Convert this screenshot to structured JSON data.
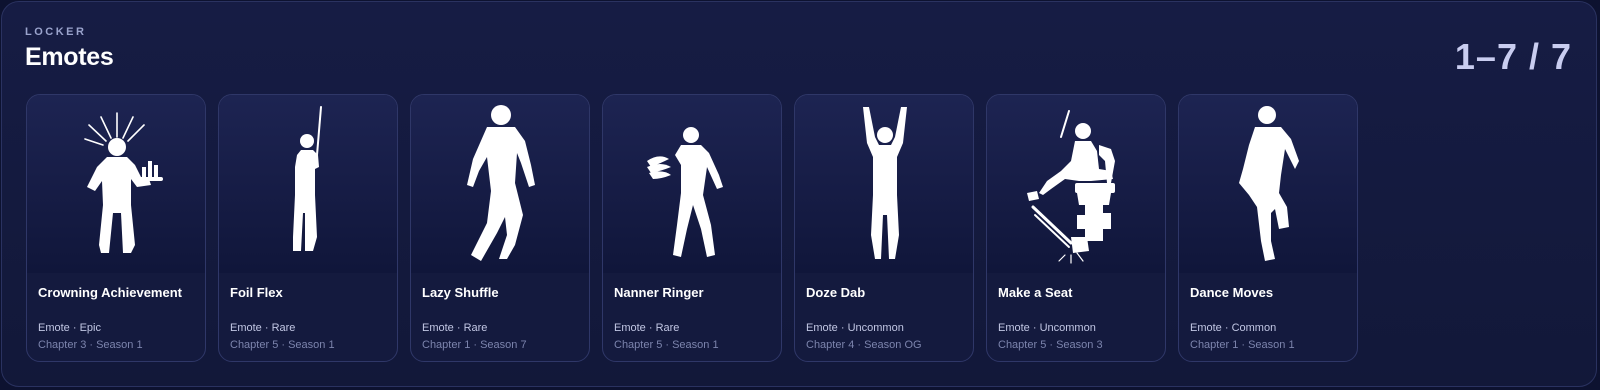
{
  "header": {
    "eyebrow": "LOCKER",
    "title": "Emotes",
    "counter": "1–7 / 7"
  },
  "cards": [
    {
      "name": "Crowning Achievement",
      "meta": "Emote · Epic",
      "season": "Chapter 3 · Season 1",
      "icon": "crowning-achievement-icon"
    },
    {
      "name": "Foil Flex",
      "meta": "Emote · Rare",
      "season": "Chapter 5 · Season 1",
      "icon": "foil-flex-icon"
    },
    {
      "name": "Lazy Shuffle",
      "meta": "Emote · Rare",
      "season": "Chapter 1 · Season 7",
      "icon": "lazy-shuffle-icon"
    },
    {
      "name": "Nanner Ringer",
      "meta": "Emote · Rare",
      "season": "Chapter 5 · Season 1",
      "icon": "nanner-ringer-icon"
    },
    {
      "name": "Doze Dab",
      "meta": "Emote · Uncommon",
      "season": "Chapter 4 · Season OG",
      "icon": "doze-dab-icon"
    },
    {
      "name": "Make a Seat",
      "meta": "Emote · Uncommon",
      "season": "Chapter 5 · Season 3",
      "icon": "make-a-seat-icon"
    },
    {
      "name": "Dance Moves",
      "meta": "Emote · Common",
      "season": "Chapter 1 · Season 1",
      "icon": "dance-moves-icon"
    }
  ],
  "colors": {
    "background": "#0d1230",
    "panel": "#161c44",
    "card": "#141a3e",
    "title": "#ffffff",
    "counter": "#c9cdf0"
  }
}
